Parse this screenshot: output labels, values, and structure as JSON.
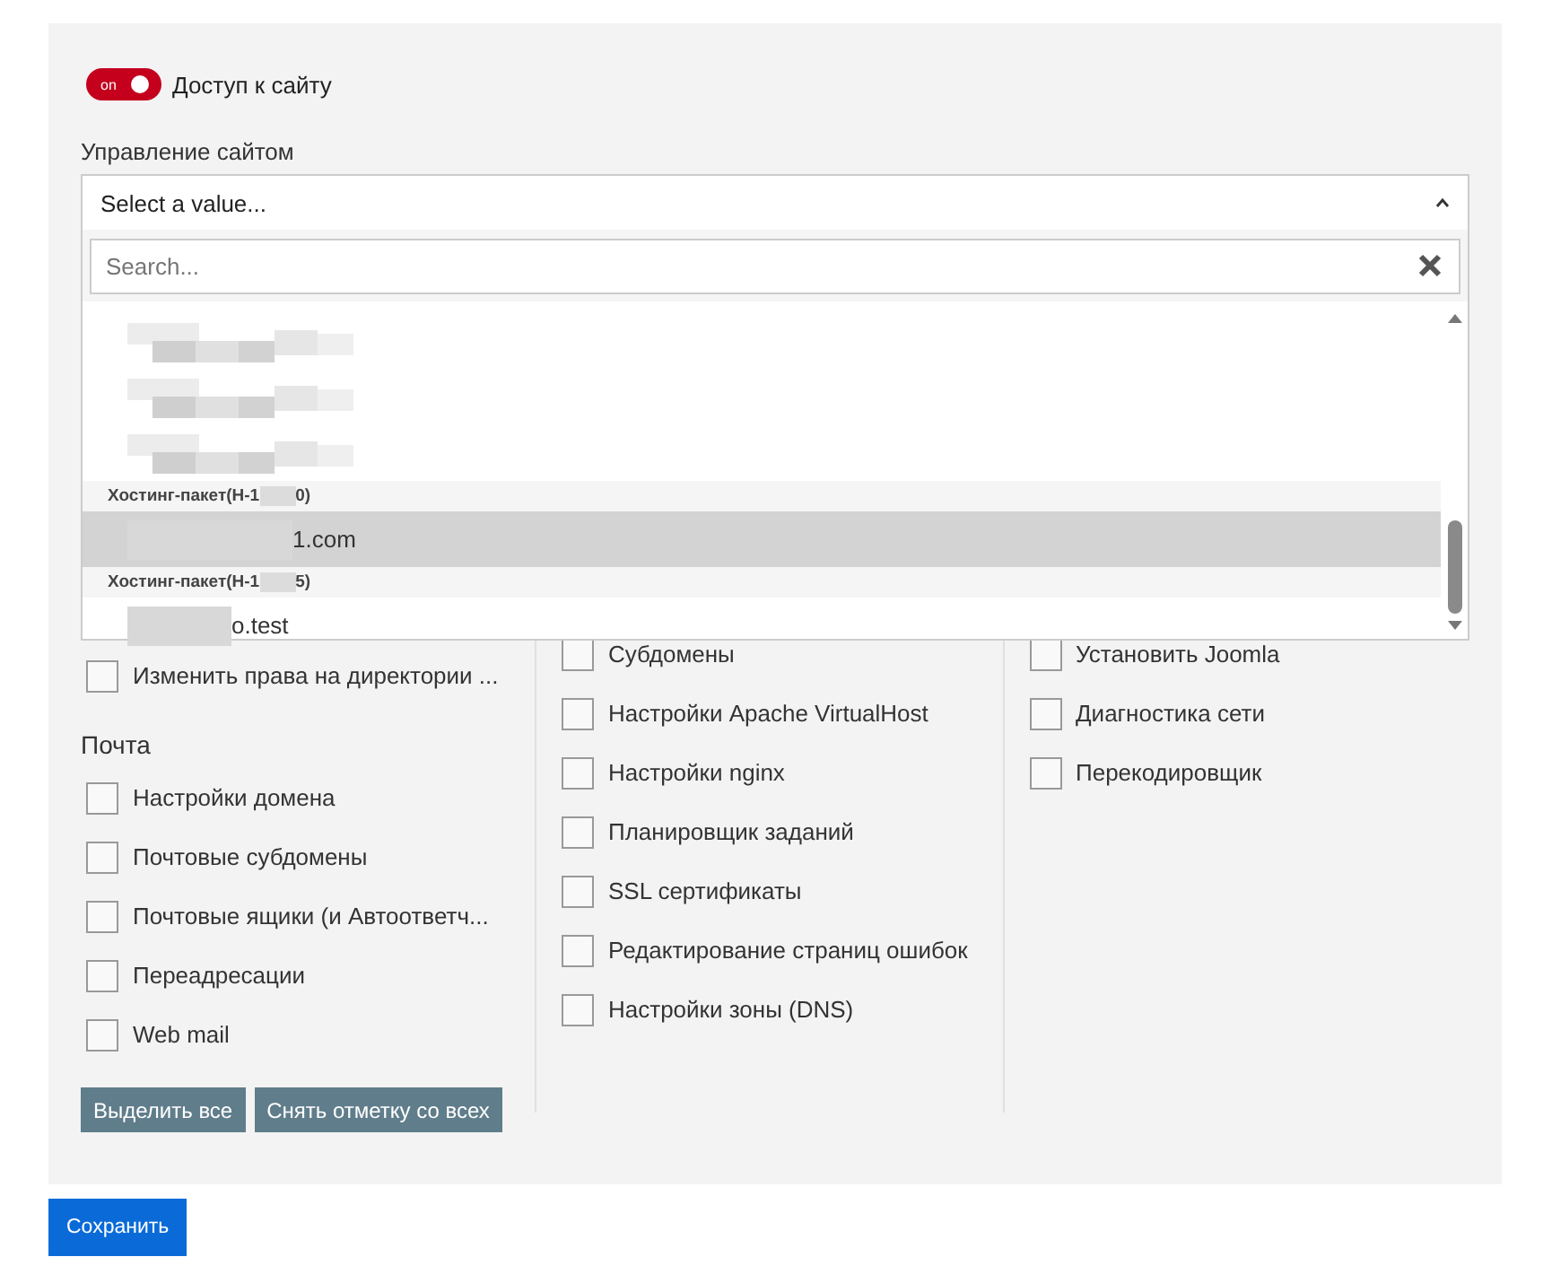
{
  "toggle": {
    "label": "Доступ к сайту",
    "text": "on",
    "on": true
  },
  "site_select": {
    "label": "Управление сайтом",
    "placeholder": "Select a value...",
    "expanded": true,
    "search": {
      "placeholder": "Search..."
    },
    "options": [
      {
        "kind": "redacted"
      },
      {
        "kind": "redacted"
      },
      {
        "kind": "redacted"
      },
      {
        "kind": "group",
        "prefix": "Хостинг-пакет(Н-1",
        "suffix": "0)"
      },
      {
        "kind": "option",
        "suffix": "1.com",
        "selected": true
      },
      {
        "kind": "group",
        "prefix": "Хостинг-пакет(Н-1",
        "suffix": "5)"
      },
      {
        "kind": "option",
        "suffix": "o.test",
        "selected": false
      }
    ]
  },
  "columns": [
    {
      "sections": [
        {
          "items": [
            {
              "label": "Изменить права на директории ...",
              "checked": false
            }
          ]
        },
        {
          "title": "Почта",
          "items": [
            {
              "label": "Настройки домена",
              "checked": false
            },
            {
              "label": "Почтовые субдомены",
              "checked": false
            },
            {
              "label": "Почтовые ящики (и Автоответч...",
              "checked": false
            },
            {
              "label": "Переадресации",
              "checked": false
            },
            {
              "label": "Web mail",
              "checked": false
            }
          ]
        }
      ]
    },
    {
      "sections": [
        {
          "items": [
            {
              "label": "Субдомены",
              "checked": false
            },
            {
              "label": "Настройки Apache VirtualHost",
              "checked": false
            },
            {
              "label": "Настройки nginx",
              "checked": false
            },
            {
              "label": "Планировщик заданий",
              "checked": false
            },
            {
              "label": "SSL сертификаты",
              "checked": false
            },
            {
              "label": "Редактирование страниц ошибок",
              "checked": false
            },
            {
              "label": "Настройки зоны (DNS)",
              "checked": false
            }
          ]
        }
      ]
    },
    {
      "sections": [
        {
          "items": [
            {
              "label": "Установить Joomla",
              "checked": false
            },
            {
              "label": "Диагностика сети",
              "checked": false
            },
            {
              "label": "Перекодировщик",
              "checked": false
            }
          ]
        }
      ]
    }
  ],
  "actions": [
    "Выделить все",
    "Снять отметку со всех"
  ],
  "save": "Сохранить"
}
